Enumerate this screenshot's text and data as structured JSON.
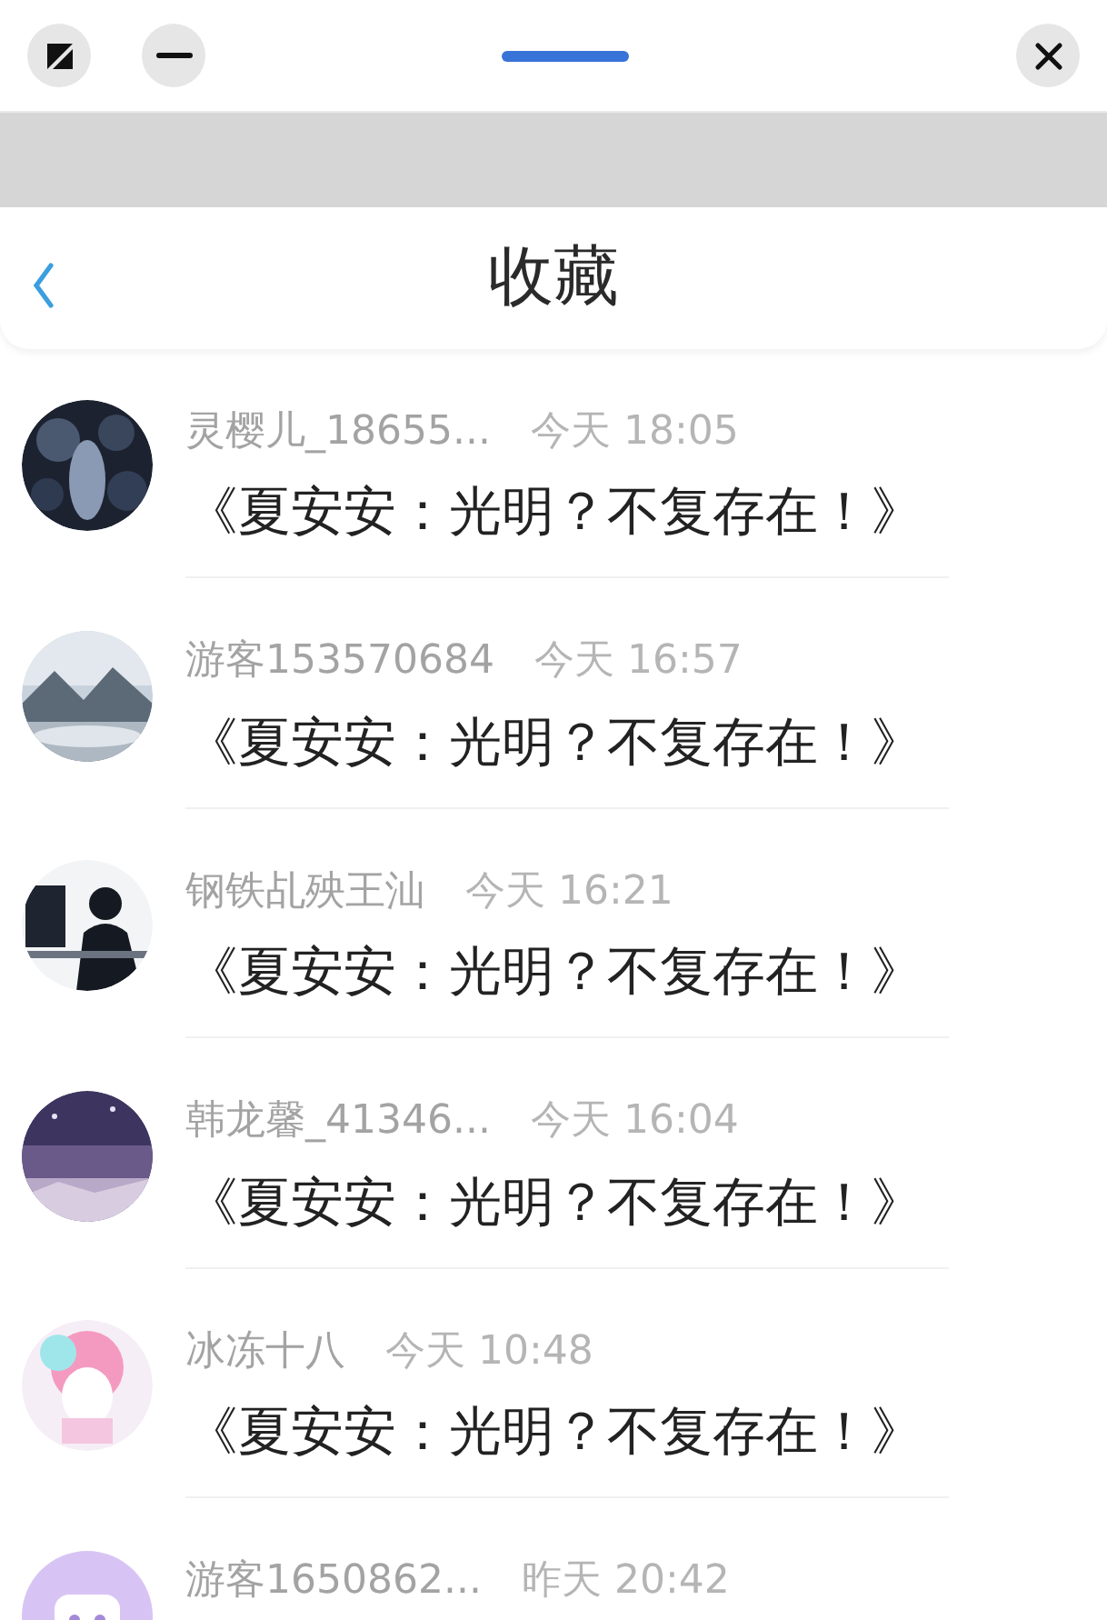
{
  "header": {
    "title": "收藏"
  },
  "items": [
    {
      "name": "灵樱儿_18655...",
      "time": "今天 18:05",
      "title": "《夏安安：光明？不复存在！》"
    },
    {
      "name": "游客153570684",
      "time": "今天 16:57",
      "title": "《夏安安：光明？不复存在！》"
    },
    {
      "name": "钢铁乩殃王汕",
      "time": "今天 16:21",
      "title": "《夏安安：光明？不复存在！》"
    },
    {
      "name": "韩龙馨_41346...",
      "time": "今天 16:04",
      "title": "《夏安安：光明？不复存在！》"
    },
    {
      "name": "冰冻十八",
      "time": "今天 10:48",
      "title": "《夏安安：光明？不复存在！》"
    },
    {
      "avatar": {
        "kind": "default"
      },
      "name": "游客1650862...",
      "time": "昨天 20:42"
    }
  ]
}
